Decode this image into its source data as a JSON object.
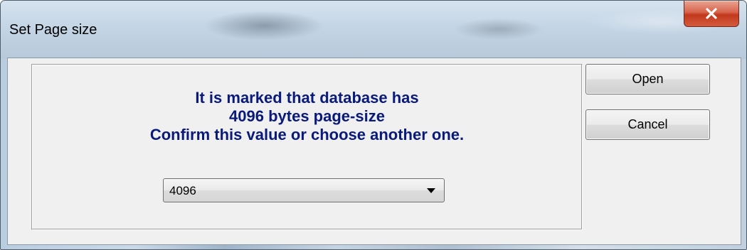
{
  "window": {
    "title": "Set Page size",
    "close_icon": "close-icon"
  },
  "message": {
    "line1": "It is marked that database has",
    "line2": "4096 bytes page-size",
    "line3": "Confirm this value or choose another one."
  },
  "page_size_select": {
    "value": "4096",
    "icon": "chevron-down-icon"
  },
  "buttons": {
    "open_label": "Open",
    "cancel_label": "Cancel"
  },
  "colors": {
    "message_text": "#0a1a7a",
    "close_button": "#c2391d"
  }
}
